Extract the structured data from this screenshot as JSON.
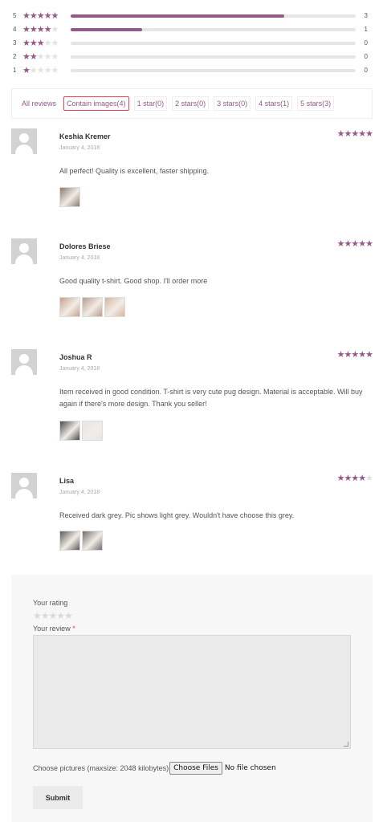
{
  "summary": {
    "rows": [
      {
        "level": "5",
        "filled": 5,
        "fill": 0.75,
        "count": "3"
      },
      {
        "level": "4",
        "filled": 4,
        "fill": 0.25,
        "count": "1"
      },
      {
        "level": "3",
        "filled": 3,
        "fill": 0,
        "count": "0"
      },
      {
        "level": "2",
        "filled": 2,
        "fill": 0,
        "count": "0"
      },
      {
        "level": "1",
        "filled": 1,
        "fill": 0,
        "count": "0"
      }
    ]
  },
  "filters": [
    "All reviews",
    "Contain images(4)",
    "1 star(0)",
    "2 stars(0)",
    "3 stars(0)",
    "4 stars(1)",
    "5 stars(3)"
  ],
  "active_filter_index": 1,
  "reviews": [
    {
      "name": "Keshia Kremer",
      "date": "January 4, 2018",
      "rating": 5,
      "text": "All perfect! Quality is excellent, faster shipping.",
      "images": [
        "#8a7a6c"
      ]
    },
    {
      "name": "Dolores Briese",
      "date": "January 4, 2018",
      "rating": 5,
      "text": "Good quality t-shirt. Good shop. I'll order more",
      "images": [
        "#c9a090",
        "#b79b8d",
        "#d3b7a1"
      ]
    },
    {
      "name": "Joshua R",
      "date": "January 4, 2018",
      "rating": 5,
      "text": "Item received in good condition. T-shirt is very cute pug design. Material is acceptable. Will buy again if there's more design. Thank you seller!",
      "images": [
        "#4a4a4a",
        "#e6e6e6"
      ]
    },
    {
      "name": "Lisa",
      "date": "January 4, 2018",
      "rating": 4,
      "text": "Received dark grey. Pic shows light grey. Wouldn't have choose this grey.",
      "images": [
        "#5a5a5a",
        "#6e6e6e"
      ]
    }
  ],
  "form": {
    "rating_label": "Your rating",
    "review_label": "Your review",
    "required_mark": "*",
    "file_label": "Choose pictures (maxsize: 2048 kilobytes)",
    "file_button": "Choose Files",
    "file_status": "No file chosen",
    "submit": "Submit"
  },
  "colors": {
    "accent": "#96588a",
    "active_border": "#e5454c"
  }
}
